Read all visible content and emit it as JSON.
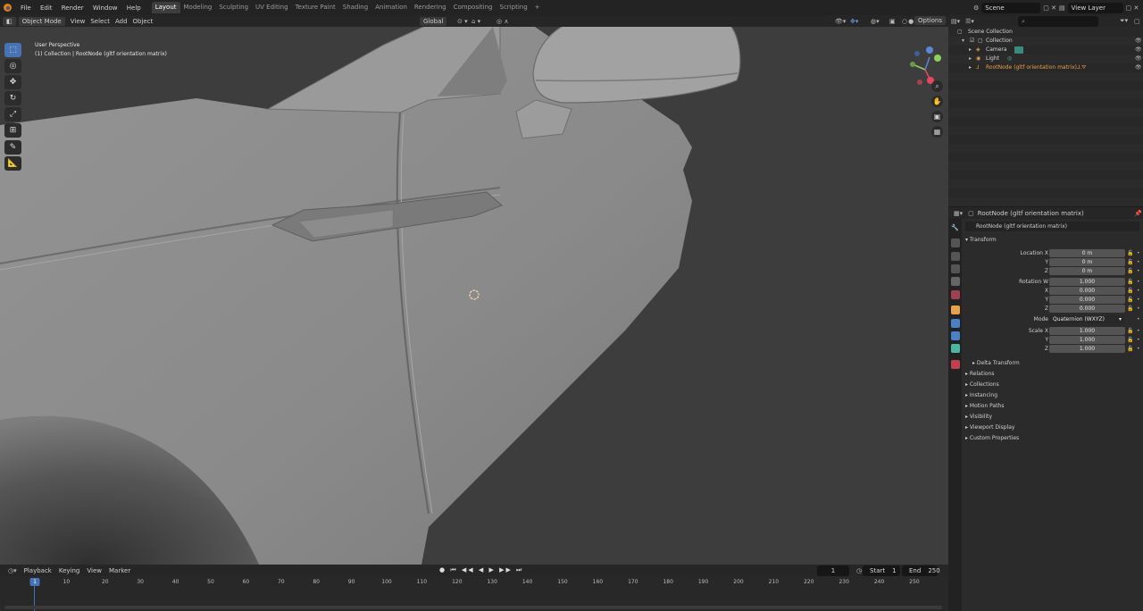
{
  "topbar": {
    "menu": [
      "File",
      "Edit",
      "Render",
      "Window",
      "Help"
    ],
    "workspaces": [
      "Layout",
      "Modeling",
      "Sculpting",
      "UV Editing",
      "Texture Paint",
      "Shading",
      "Animation",
      "Rendering",
      "Compositing",
      "Scripting"
    ],
    "active_workspace": "Layout",
    "add_tab": "+",
    "scene_label": "Scene",
    "view_layer_label": "View Layer"
  },
  "viewport_header": {
    "mode": "Object Mode",
    "menus": [
      "View",
      "Select",
      "Add",
      "Object"
    ],
    "orientation": "Global",
    "options": "Options"
  },
  "viewport": {
    "perspective": "User Perspective",
    "collection_info": "(1) Collection | RootNode (gltf orientation matrix)",
    "gizmo": {
      "x": "X",
      "y": "Y",
      "z": "Z"
    },
    "colors": {
      "background": "#3d3d3d",
      "body": "#8c8c8c",
      "accent": "#4772b3"
    },
    "tools": [
      "select-box",
      "cursor",
      "move",
      "rotate",
      "scale",
      "transform",
      "annotate",
      "measure"
    ]
  },
  "timeline": {
    "menus": [
      "Playback",
      "Keying",
      "View",
      "Marker"
    ],
    "current_frame": "1",
    "start_label": "Start",
    "start_value": "1",
    "end_label": "End",
    "end_value": "250",
    "ticks": [
      "10",
      "20",
      "30",
      "40",
      "50",
      "60",
      "70",
      "80",
      "90",
      "100",
      "110",
      "120",
      "130",
      "140",
      "150",
      "160",
      "170",
      "180",
      "190",
      "200",
      "210",
      "220",
      "230",
      "240",
      "250"
    ]
  },
  "outliner": {
    "search_placeholder": "",
    "rows": [
      {
        "label": "Scene Collection",
        "icon": "collection-icon"
      },
      {
        "label": "Collection",
        "icon": "collection-icon"
      },
      {
        "label": "Camera",
        "icon": "camera-icon"
      },
      {
        "label": "Light",
        "icon": "light-icon"
      },
      {
        "label": "RootNode (gltf orientation matrix)",
        "icon": "empty-icon"
      }
    ]
  },
  "properties": {
    "header_title": "RootNode (gltf orientation matrix)",
    "object_name": "RootNode (gltf orientation matrix)",
    "transform_title": "Transform",
    "location_label": "Location X",
    "location": [
      "0 m",
      "0 m",
      "0 m"
    ],
    "rotation_label": "Rotation W",
    "rotation": [
      "1.000",
      "0.000",
      "0.000",
      "0.000"
    ],
    "axis_labels": [
      "Y",
      "Z",
      "X",
      "Y",
      "Z"
    ],
    "mode_label": "Mode",
    "mode_value": "Quaternion (WXYZ)",
    "scale_label": "Scale X",
    "scale": [
      "1.000",
      "1.000",
      "1.000"
    ],
    "delta_transform": "Delta Transform",
    "sections": [
      "Relations",
      "Collections",
      "Instancing",
      "Motion Paths",
      "Visibility",
      "Viewport Display",
      "Custom Properties"
    ]
  }
}
